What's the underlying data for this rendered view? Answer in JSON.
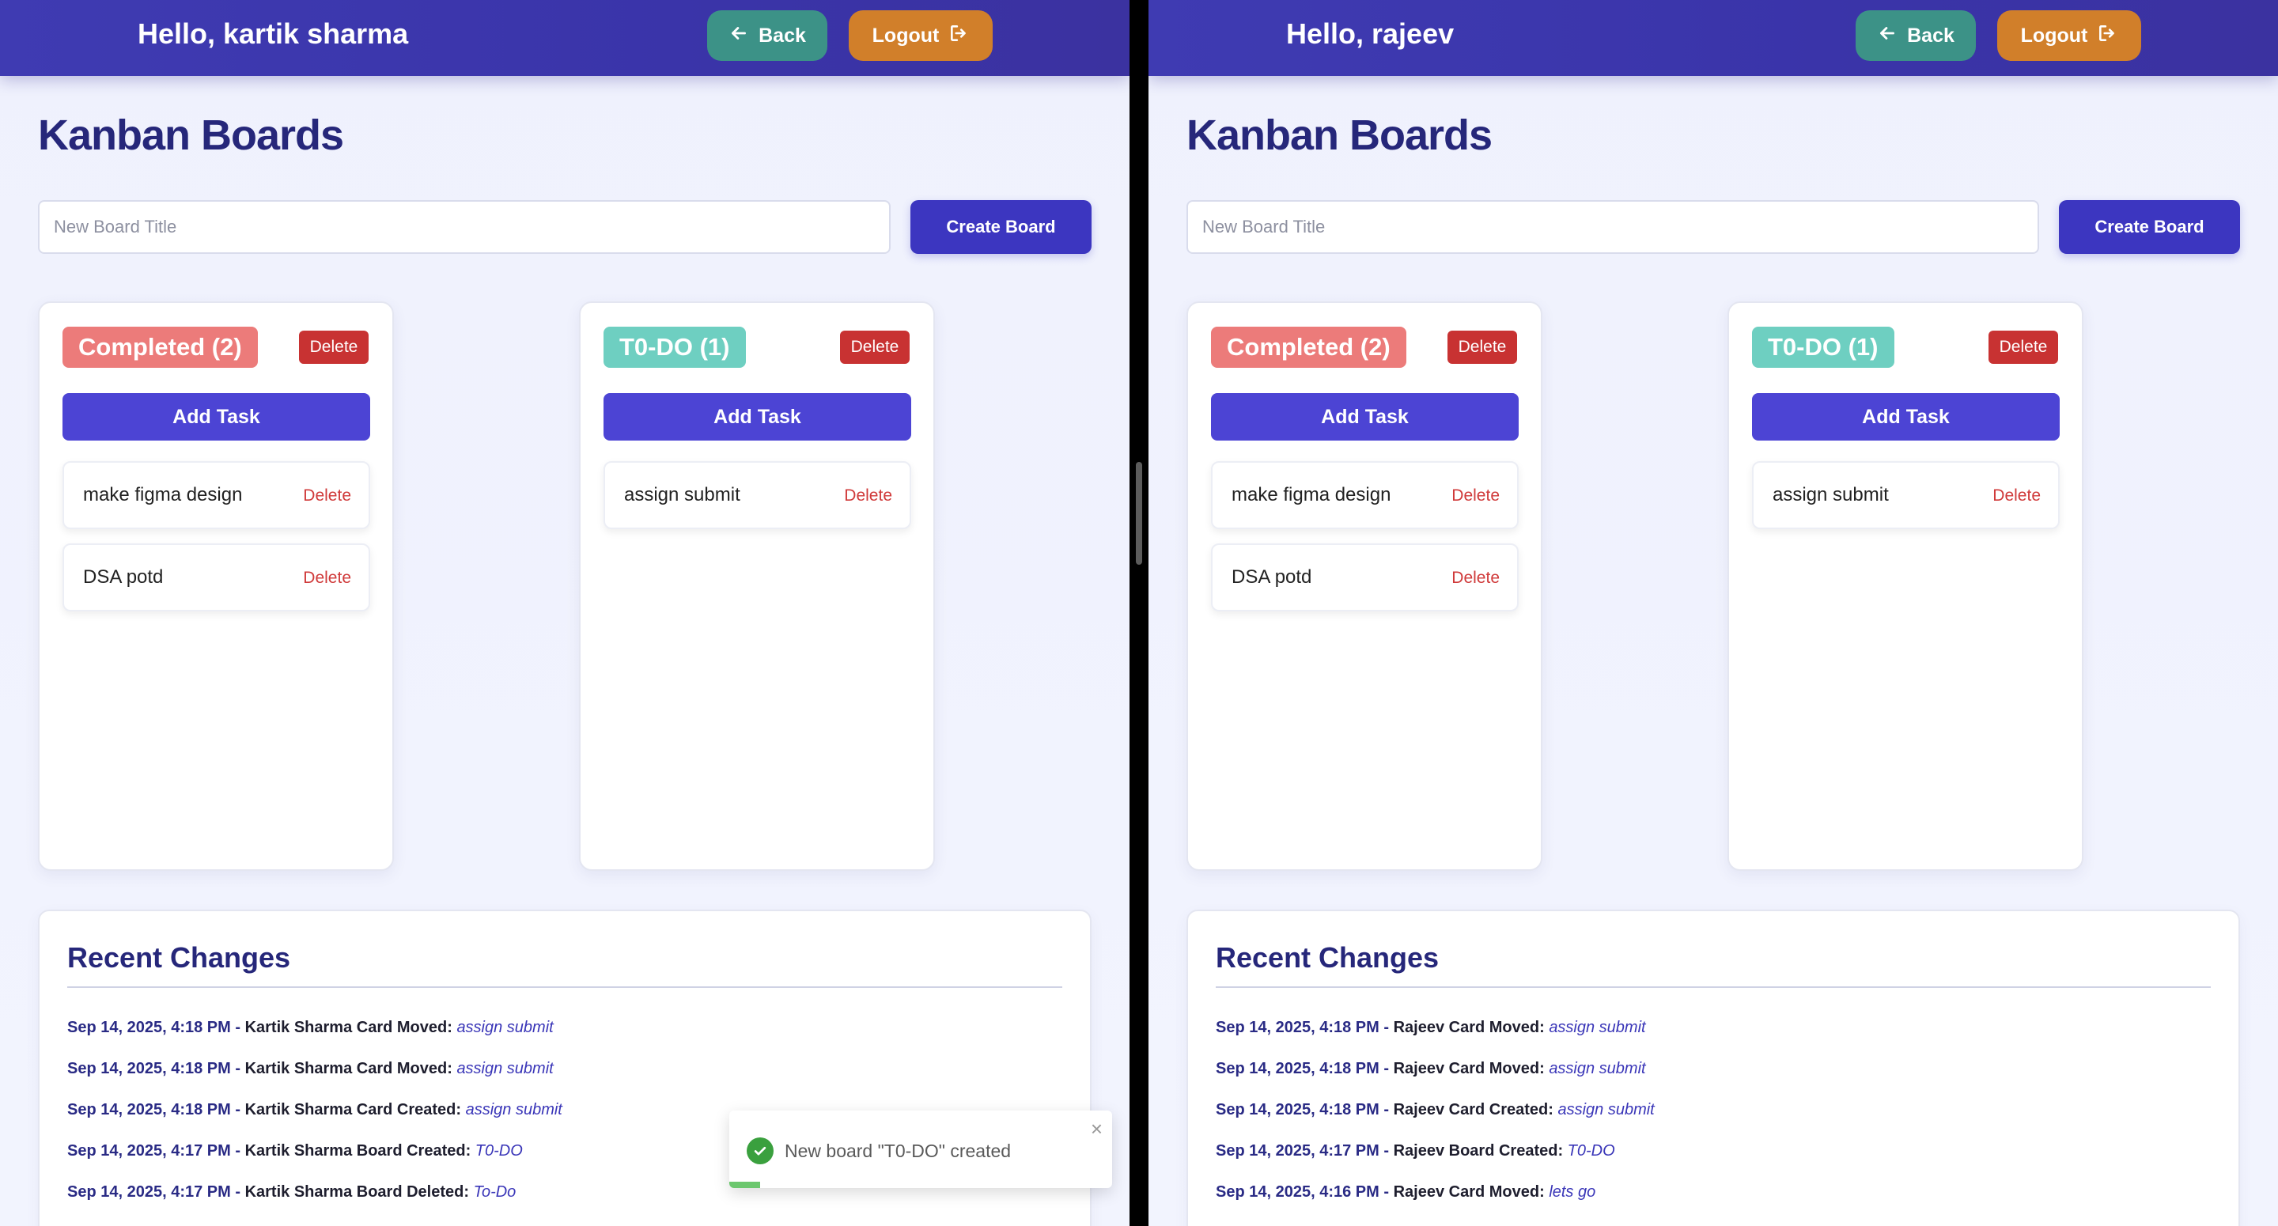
{
  "left": {
    "greeting": "Hello, kartik sharma",
    "back_label": "Back",
    "logout_label": "Logout",
    "page_title": "Kanban Boards",
    "new_board_placeholder": "New Board Title",
    "create_board_label": "Create Board",
    "boards": [
      {
        "title": "Completed (2)",
        "title_color": "#ec7b7a",
        "delete_label": "Delete",
        "add_task_label": "Add Task",
        "tasks": [
          {
            "title": "make figma design",
            "delete_label": "Delete"
          },
          {
            "title": "DSA potd",
            "delete_label": "Delete"
          }
        ]
      },
      {
        "title": "T0-DO (1)",
        "title_color": "#6ecfc1",
        "delete_label": "Delete",
        "add_task_label": "Add Task",
        "tasks": [
          {
            "title": "assign submit",
            "delete_label": "Delete"
          }
        ]
      }
    ],
    "recent_changes_title": "Recent Changes",
    "changes": [
      {
        "time": "Sep 14, 2025, 4:18 PM",
        "sep": " - ",
        "text": "Kartik Sharma Card Moved",
        "colon": ": ",
        "target": "assign submit"
      },
      {
        "time": "Sep 14, 2025, 4:18 PM",
        "sep": " - ",
        "text": "Kartik Sharma Card Moved",
        "colon": ": ",
        "target": "assign submit"
      },
      {
        "time": "Sep 14, 2025, 4:18 PM",
        "sep": " - ",
        "text": "Kartik Sharma Card Created",
        "colon": ": ",
        "target": "assign submit"
      },
      {
        "time": "Sep 14, 2025, 4:17 PM",
        "sep": " - ",
        "text": "Kartik Sharma Board Created",
        "colon": ": ",
        "target": "T0-DO"
      },
      {
        "time": "Sep 14, 2025, 4:17 PM",
        "sep": " - ",
        "text": "Kartik Sharma Board Deleted",
        "colon": ": ",
        "target": "To-Do"
      }
    ],
    "toast": {
      "message": "New board \"T0-DO\" created",
      "close": "×",
      "progress": 0.08
    }
  },
  "right": {
    "greeting": "Hello, rajeev",
    "back_label": "Back",
    "logout_label": "Logout",
    "page_title": "Kanban Boards",
    "new_board_placeholder": "New Board Title",
    "create_board_label": "Create Board",
    "boards": [
      {
        "title": "Completed (2)",
        "title_color": "#ec7b7a",
        "delete_label": "Delete",
        "add_task_label": "Add Task",
        "tasks": [
          {
            "title": "make figma design",
            "delete_label": "Delete"
          },
          {
            "title": "DSA potd",
            "delete_label": "Delete"
          }
        ]
      },
      {
        "title": "T0-DO (1)",
        "title_color": "#6ecfc1",
        "delete_label": "Delete",
        "add_task_label": "Add Task",
        "tasks": [
          {
            "title": "assign submit",
            "delete_label": "Delete"
          }
        ]
      }
    ],
    "recent_changes_title": "Recent Changes",
    "changes": [
      {
        "time": "Sep 14, 2025, 4:18 PM",
        "sep": " - ",
        "text": "Rajeev Card Moved",
        "colon": ": ",
        "target": "assign submit"
      },
      {
        "time": "Sep 14, 2025, 4:18 PM",
        "sep": " - ",
        "text": "Rajeev Card Moved",
        "colon": ": ",
        "target": "assign submit"
      },
      {
        "time": "Sep 14, 2025, 4:18 PM",
        "sep": " - ",
        "text": "Rajeev Card Created",
        "colon": ": ",
        "target": "assign submit"
      },
      {
        "time": "Sep 14, 2025, 4:17 PM",
        "sep": " - ",
        "text": "Rajeev Board Created",
        "colon": ": ",
        "target": "T0-DO"
      },
      {
        "time": "Sep 14, 2025, 4:16 PM",
        "sep": " - ",
        "text": "Rajeev Card Moved",
        "colon": ": ",
        "target": "lets go"
      }
    ]
  },
  "colors": {
    "header": "#3f3bb2",
    "back_button": "#3c9287",
    "logout_button": "#d17f2a",
    "primary": "#3c36c0",
    "danger": "#c83232",
    "title_text": "#26277a",
    "toast_success": "#3aa03e"
  },
  "icons": {
    "back": "arrow-left-icon",
    "logout": "logout-icon",
    "toast": "check-circle-icon",
    "close": "close-icon"
  }
}
